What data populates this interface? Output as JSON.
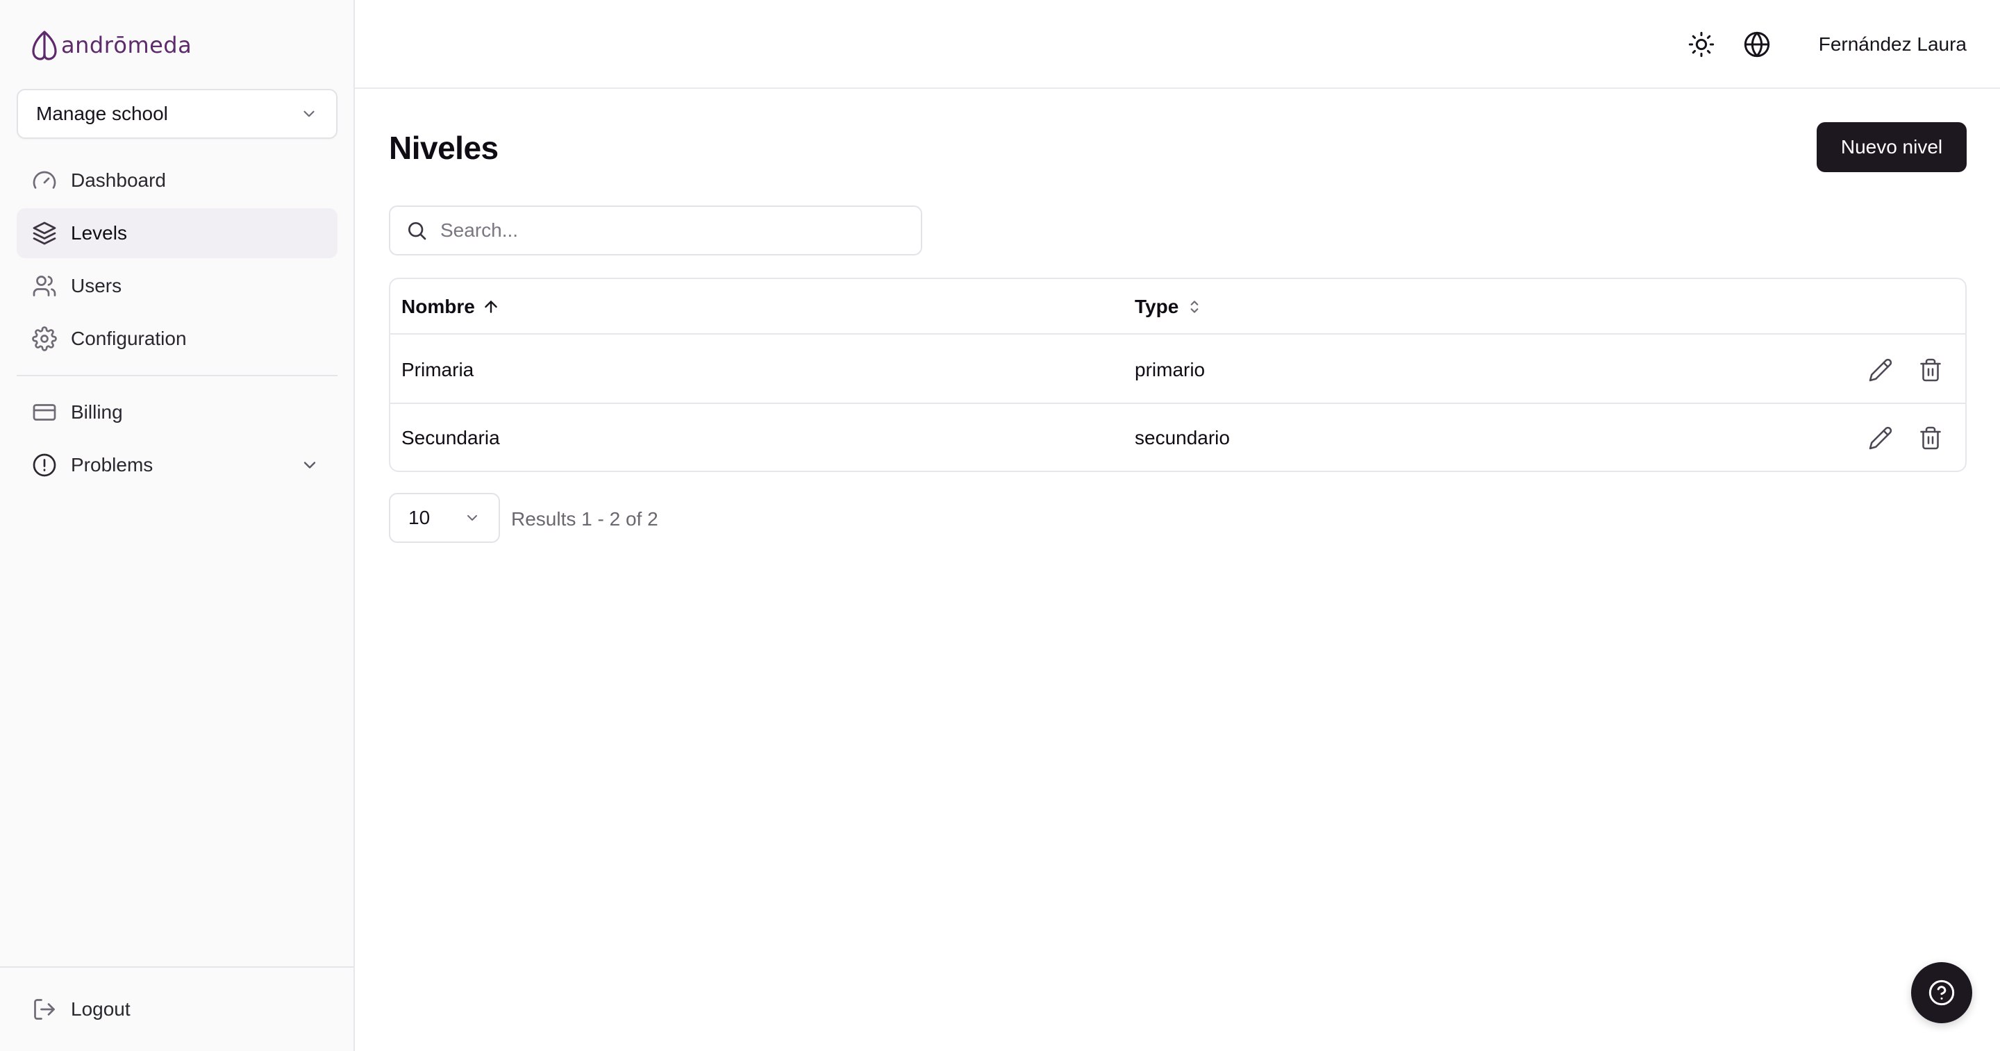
{
  "brand": {
    "name": "andrōmeda",
    "color": "#5e2a6b"
  },
  "sidebar": {
    "school_select": {
      "value": "Manage school",
      "icon": "chevron-down-icon"
    },
    "items": [
      {
        "label": "Dashboard",
        "icon": "gauge-icon",
        "active": false
      },
      {
        "label": "Levels",
        "icon": "layers-icon",
        "active": true
      },
      {
        "label": "Users",
        "icon": "users-icon",
        "active": false
      },
      {
        "label": "Configuration",
        "icon": "gear-icon",
        "active": false
      },
      {
        "label": "Billing",
        "icon": "credit-card-icon",
        "active": false
      },
      {
        "label": "Problems",
        "icon": "alert-circle-icon",
        "active": false,
        "expandable": true
      }
    ],
    "logout": {
      "label": "Logout",
      "icon": "logout-icon"
    }
  },
  "header": {
    "theme_icon": "sun-icon",
    "language_icon": "globe-icon",
    "user_name": "Fernández Laura"
  },
  "main": {
    "title": "Niveles",
    "new_button_label": "Nuevo nivel",
    "search": {
      "placeholder": "Search...",
      "value": ""
    },
    "table": {
      "columns": [
        {
          "label": "Nombre",
          "sort": "asc"
        },
        {
          "label": "Type",
          "sort": "none"
        }
      ],
      "rows": [
        {
          "nombre": "Primaria",
          "type": "primario"
        },
        {
          "nombre": "Secundaria",
          "type": "secundario"
        }
      ],
      "row_actions": [
        "pencil-icon",
        "trash-icon"
      ]
    },
    "pagination": {
      "page_size": "10",
      "results_text": "Results 1 - 2 of 2"
    }
  },
  "help_button": {
    "icon": "help-circle-icon"
  },
  "colors": {
    "primary_button": "#1d1720",
    "sidebar_bg": "#fafafa",
    "active_item_bg": "#f1eff3",
    "border": "#e8e6eb"
  }
}
